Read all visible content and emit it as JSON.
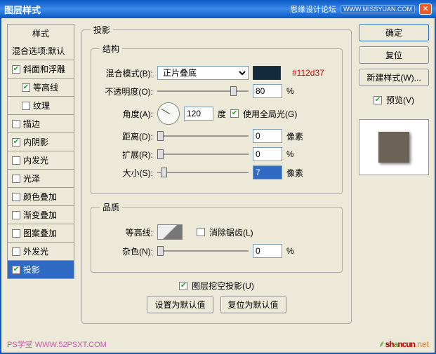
{
  "titlebar": {
    "title": "图层样式",
    "forum": "思缘设计论坛",
    "forum_url": "WWW.MISSYUAN.COM"
  },
  "styles": {
    "header": "样式",
    "blend_opts": "混合选项:默认",
    "items": [
      {
        "label": "斜面和浮雕",
        "checked": true,
        "indent": false
      },
      {
        "label": "等高线",
        "checked": true,
        "indent": true
      },
      {
        "label": "纹理",
        "checked": false,
        "indent": true
      },
      {
        "label": "描边",
        "checked": false,
        "indent": false
      },
      {
        "label": "内阴影",
        "checked": true,
        "indent": false
      },
      {
        "label": "内发光",
        "checked": false,
        "indent": false
      },
      {
        "label": "光泽",
        "checked": false,
        "indent": false
      },
      {
        "label": "颜色叠加",
        "checked": false,
        "indent": false
      },
      {
        "label": "渐变叠加",
        "checked": false,
        "indent": false
      },
      {
        "label": "图案叠加",
        "checked": false,
        "indent": false
      },
      {
        "label": "外发光",
        "checked": false,
        "indent": false
      },
      {
        "label": "投影",
        "checked": true,
        "indent": false,
        "selected": true
      }
    ]
  },
  "panel": {
    "title": "投影",
    "structure": {
      "legend": "结构",
      "blend_mode_label": "混合模式(B):",
      "blend_mode_value": "正片叠底",
      "hex": "#112d37",
      "opacity_label": "不透明度(O):",
      "opacity_value": "80",
      "pct": "%",
      "angle_label": "角度(A):",
      "angle_value": "120",
      "angle_unit": "度",
      "global_light": "使用全局光(G)",
      "distance_label": "距离(D):",
      "distance_value": "0",
      "px": "像素",
      "spread_label": "扩展(R):",
      "spread_value": "0",
      "size_label": "大小(S):",
      "size_value": "7"
    },
    "quality": {
      "legend": "品质",
      "contour_label": "等高线:",
      "antialias": "消除锯齿(L)",
      "noise_label": "杂色(N):",
      "noise_value": "0",
      "pct": "%"
    },
    "knockout": "图层挖空投影(U)",
    "defaults_set": "设置为默认值",
    "defaults_reset": "复位为默认值"
  },
  "actions": {
    "ok": "确定",
    "cancel": "复位",
    "new_style": "新建样式(W)...",
    "preview": "预览(V)"
  },
  "watermark": {
    "left": "PS学堂  WWW.52PSXT.COM",
    "brand_pre": "sh",
    "brand_a": "a",
    "brand_post": "ncun",
    "net": ".net"
  }
}
